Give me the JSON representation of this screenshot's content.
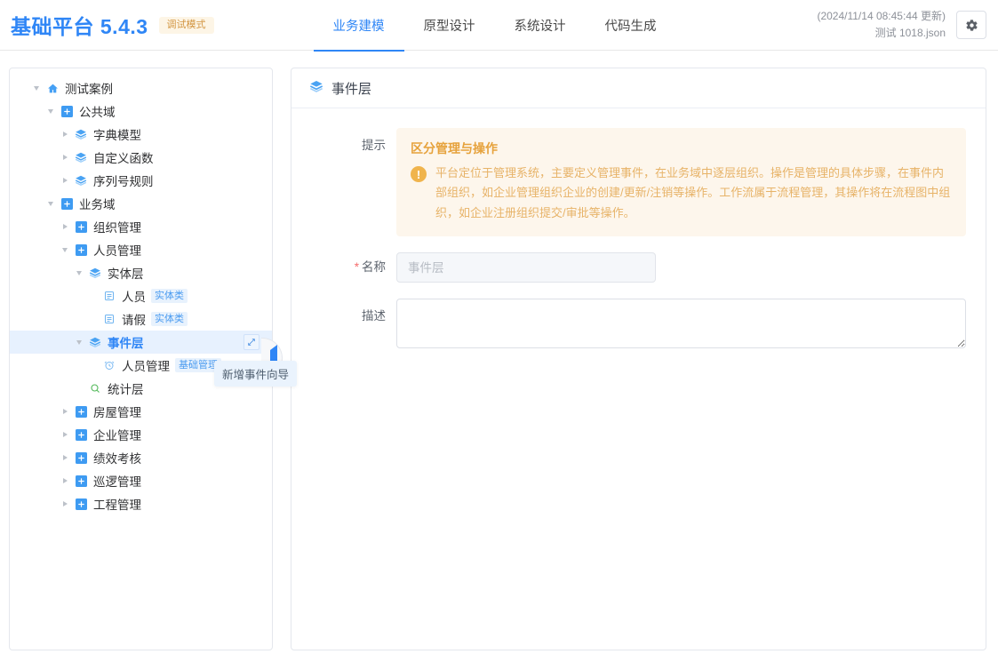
{
  "header": {
    "brand_title": "基础平台 5.4.3",
    "brand_badge": "调试模式",
    "nav": [
      {
        "label": "业务建模",
        "active": true
      },
      {
        "label": "原型设计",
        "active": false
      },
      {
        "label": "系统设计",
        "active": false
      },
      {
        "label": "代码生成",
        "active": false
      }
    ],
    "meta_line1": "(2024/11/14 08:45:44 更新)",
    "meta_line2": "测试 1018.json",
    "settings_icon": "gear-icon"
  },
  "sidebar": {
    "tree": [
      {
        "label": "测试案例",
        "indent": 0,
        "caret": "down",
        "icon": "home-icon",
        "tag": ""
      },
      {
        "label": "公共域",
        "indent": 1,
        "caret": "down",
        "icon": "domain-icon",
        "tag": ""
      },
      {
        "label": "字典模型",
        "indent": 2,
        "caret": "right",
        "icon": "layer-icon",
        "tag": ""
      },
      {
        "label": "自定义函数",
        "indent": 2,
        "caret": "right",
        "icon": "layer-icon",
        "tag": ""
      },
      {
        "label": "序列号规则",
        "indent": 2,
        "caret": "right",
        "icon": "layer-icon",
        "tag": ""
      },
      {
        "label": "业务域",
        "indent": 1,
        "caret": "down",
        "icon": "domain-icon",
        "tag": ""
      },
      {
        "label": "组织管理",
        "indent": 2,
        "caret": "right",
        "icon": "domain-icon",
        "tag": ""
      },
      {
        "label": "人员管理",
        "indent": 2,
        "caret": "down",
        "icon": "domain-icon",
        "tag": ""
      },
      {
        "label": "实体层",
        "indent": 3,
        "caret": "down",
        "icon": "layer-icon",
        "tag": ""
      },
      {
        "label": "人员",
        "indent": 4,
        "caret": "none",
        "icon": "entity-icon",
        "tag": "实体类"
      },
      {
        "label": "请假",
        "indent": 4,
        "caret": "none",
        "icon": "entity-icon",
        "tag": "实体类"
      },
      {
        "label": "事件层",
        "indent": 3,
        "caret": "down",
        "icon": "layer-icon",
        "tag": "",
        "selected": true,
        "action_icon": "edit-square-icon"
      },
      {
        "label": "人员管理",
        "indent": 4,
        "caret": "none",
        "icon": "clock-icon",
        "tag": "基础管理"
      },
      {
        "label": "统计层",
        "indent": 3,
        "caret": "none",
        "icon": "search-icon",
        "tag": ""
      },
      {
        "label": "房屋管理",
        "indent": 2,
        "caret": "right",
        "icon": "domain-icon",
        "tag": ""
      },
      {
        "label": "企业管理",
        "indent": 2,
        "caret": "right",
        "icon": "domain-icon",
        "tag": ""
      },
      {
        "label": "绩效考核",
        "indent": 2,
        "caret": "right",
        "icon": "domain-icon",
        "tag": ""
      },
      {
        "label": "巡逻管理",
        "indent": 2,
        "caret": "right",
        "icon": "domain-icon",
        "tag": ""
      },
      {
        "label": "工程管理",
        "indent": 2,
        "caret": "right",
        "icon": "domain-icon",
        "tag": ""
      }
    ],
    "tooltip": "新增事件向导",
    "collapse_handle_icon": "triangle-left-icon"
  },
  "panel": {
    "title": "事件层",
    "title_icon": "layer-icon",
    "tip_label": "提示",
    "alert": {
      "title": "区分管理与操作",
      "icon": "exclamation-icon",
      "text": "平台定位于管理系统，主要定义管理事件，在业务域中逐层组织。操作是管理的具体步骤，在事件内部组织，如企业管理组织企业的创建/更新/注销等操作。工作流属于流程管理，其操作将在流程图中组织，如企业注册组织提交/审批等操作。"
    },
    "name_label": "名称",
    "name_value": "",
    "name_placeholder": "事件层",
    "desc_label": "描述",
    "desc_value": "",
    "desc_placeholder": ""
  },
  "colors": {
    "brand_blue": "#2f86f6",
    "badge_orange": "#d39642",
    "alert_bg": "#fdf6ec",
    "alert_orange": "#e6a23c",
    "tag_blue": "#4a9bf0",
    "selected_bg": "#e7f1fe",
    "green_icon": "#5cb85c"
  }
}
